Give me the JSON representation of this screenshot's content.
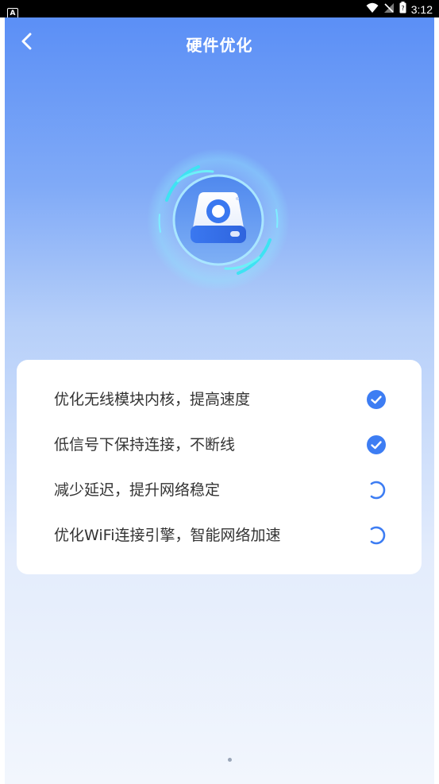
{
  "status_bar": {
    "app_badge": "A",
    "time": "3:12",
    "icons": [
      "wifi-icon",
      "no-signal-icon",
      "battery-icon"
    ]
  },
  "header": {
    "title": "硬件优化",
    "back_icon": "chevron-left-icon"
  },
  "hero": {
    "icon": "hard-drive-icon"
  },
  "tasks": [
    {
      "label": "优化无线模块内核，提高速度",
      "status": "done"
    },
    {
      "label": "低信号下保持连接，不断线",
      "status": "done"
    },
    {
      "label": "减少延迟，提升网络稳定",
      "status": "loading"
    },
    {
      "label": "优化WiFi连接引擎，智能网络加速",
      "status": "loading"
    }
  ],
  "colors": {
    "accent": "#3d7df3",
    "header_gradient_top": "#5b8ff6",
    "background_bottom": "#f2f6fd",
    "ring_cyan": "#3ee3f2",
    "text": "#333333"
  }
}
